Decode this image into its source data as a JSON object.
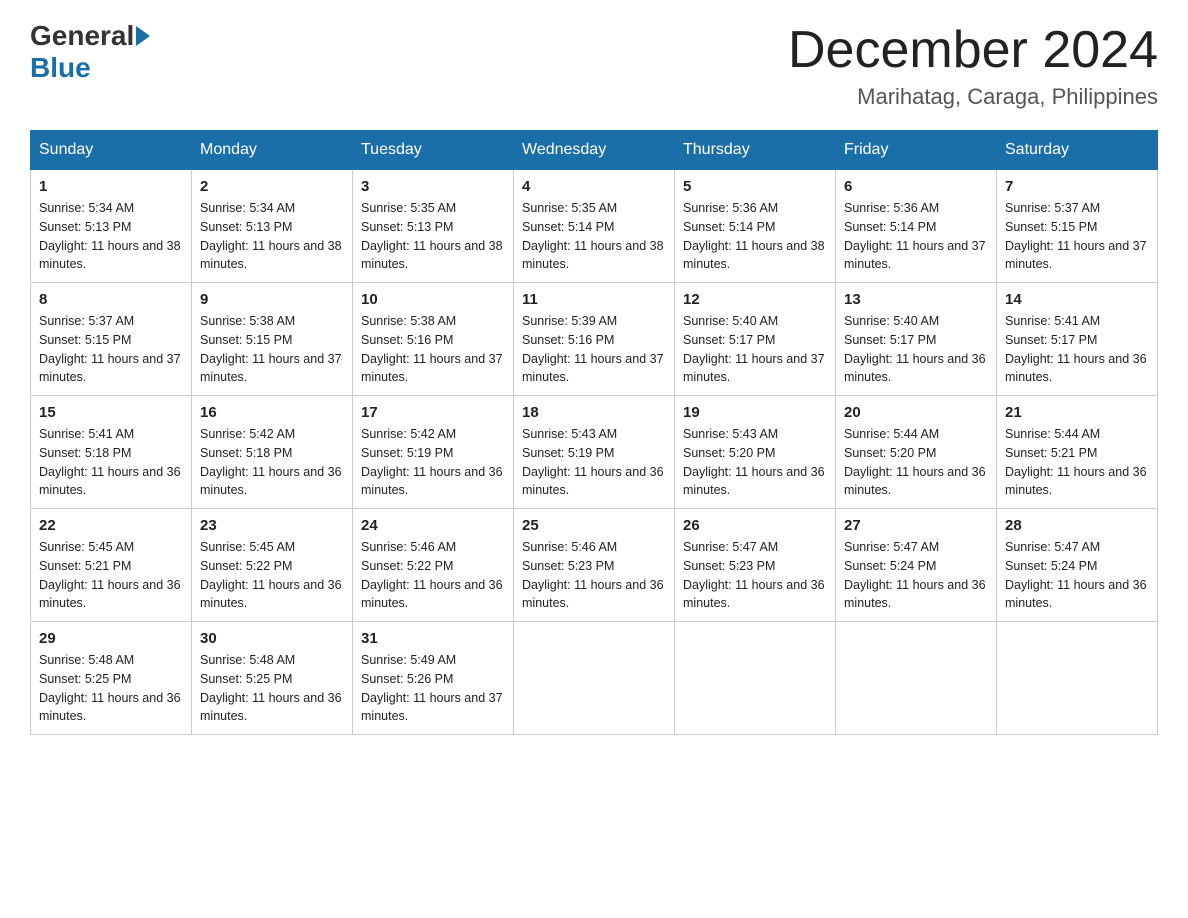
{
  "header": {
    "logo_general": "General",
    "logo_blue": "Blue",
    "month_title": "December 2024",
    "location": "Marihatag, Caraga, Philippines"
  },
  "days_of_week": [
    "Sunday",
    "Monday",
    "Tuesday",
    "Wednesday",
    "Thursday",
    "Friday",
    "Saturday"
  ],
  "weeks": [
    [
      {
        "day": "1",
        "sunrise": "5:34 AM",
        "sunset": "5:13 PM",
        "daylight": "11 hours and 38 minutes."
      },
      {
        "day": "2",
        "sunrise": "5:34 AM",
        "sunset": "5:13 PM",
        "daylight": "11 hours and 38 minutes."
      },
      {
        "day": "3",
        "sunrise": "5:35 AM",
        "sunset": "5:13 PM",
        "daylight": "11 hours and 38 minutes."
      },
      {
        "day": "4",
        "sunrise": "5:35 AM",
        "sunset": "5:14 PM",
        "daylight": "11 hours and 38 minutes."
      },
      {
        "day": "5",
        "sunrise": "5:36 AM",
        "sunset": "5:14 PM",
        "daylight": "11 hours and 38 minutes."
      },
      {
        "day": "6",
        "sunrise": "5:36 AM",
        "sunset": "5:14 PM",
        "daylight": "11 hours and 37 minutes."
      },
      {
        "day": "7",
        "sunrise": "5:37 AM",
        "sunset": "5:15 PM",
        "daylight": "11 hours and 37 minutes."
      }
    ],
    [
      {
        "day": "8",
        "sunrise": "5:37 AM",
        "sunset": "5:15 PM",
        "daylight": "11 hours and 37 minutes."
      },
      {
        "day": "9",
        "sunrise": "5:38 AM",
        "sunset": "5:15 PM",
        "daylight": "11 hours and 37 minutes."
      },
      {
        "day": "10",
        "sunrise": "5:38 AM",
        "sunset": "5:16 PM",
        "daylight": "11 hours and 37 minutes."
      },
      {
        "day": "11",
        "sunrise": "5:39 AM",
        "sunset": "5:16 PM",
        "daylight": "11 hours and 37 minutes."
      },
      {
        "day": "12",
        "sunrise": "5:40 AM",
        "sunset": "5:17 PM",
        "daylight": "11 hours and 37 minutes."
      },
      {
        "day": "13",
        "sunrise": "5:40 AM",
        "sunset": "5:17 PM",
        "daylight": "11 hours and 36 minutes."
      },
      {
        "day": "14",
        "sunrise": "5:41 AM",
        "sunset": "5:17 PM",
        "daylight": "11 hours and 36 minutes."
      }
    ],
    [
      {
        "day": "15",
        "sunrise": "5:41 AM",
        "sunset": "5:18 PM",
        "daylight": "11 hours and 36 minutes."
      },
      {
        "day": "16",
        "sunrise": "5:42 AM",
        "sunset": "5:18 PM",
        "daylight": "11 hours and 36 minutes."
      },
      {
        "day": "17",
        "sunrise": "5:42 AM",
        "sunset": "5:19 PM",
        "daylight": "11 hours and 36 minutes."
      },
      {
        "day": "18",
        "sunrise": "5:43 AM",
        "sunset": "5:19 PM",
        "daylight": "11 hours and 36 minutes."
      },
      {
        "day": "19",
        "sunrise": "5:43 AM",
        "sunset": "5:20 PM",
        "daylight": "11 hours and 36 minutes."
      },
      {
        "day": "20",
        "sunrise": "5:44 AM",
        "sunset": "5:20 PM",
        "daylight": "11 hours and 36 minutes."
      },
      {
        "day": "21",
        "sunrise": "5:44 AM",
        "sunset": "5:21 PM",
        "daylight": "11 hours and 36 minutes."
      }
    ],
    [
      {
        "day": "22",
        "sunrise": "5:45 AM",
        "sunset": "5:21 PM",
        "daylight": "11 hours and 36 minutes."
      },
      {
        "day": "23",
        "sunrise": "5:45 AM",
        "sunset": "5:22 PM",
        "daylight": "11 hours and 36 minutes."
      },
      {
        "day": "24",
        "sunrise": "5:46 AM",
        "sunset": "5:22 PM",
        "daylight": "11 hours and 36 minutes."
      },
      {
        "day": "25",
        "sunrise": "5:46 AM",
        "sunset": "5:23 PM",
        "daylight": "11 hours and 36 minutes."
      },
      {
        "day": "26",
        "sunrise": "5:47 AM",
        "sunset": "5:23 PM",
        "daylight": "11 hours and 36 minutes."
      },
      {
        "day": "27",
        "sunrise": "5:47 AM",
        "sunset": "5:24 PM",
        "daylight": "11 hours and 36 minutes."
      },
      {
        "day": "28",
        "sunrise": "5:47 AM",
        "sunset": "5:24 PM",
        "daylight": "11 hours and 36 minutes."
      }
    ],
    [
      {
        "day": "29",
        "sunrise": "5:48 AM",
        "sunset": "5:25 PM",
        "daylight": "11 hours and 36 minutes."
      },
      {
        "day": "30",
        "sunrise": "5:48 AM",
        "sunset": "5:25 PM",
        "daylight": "11 hours and 36 minutes."
      },
      {
        "day": "31",
        "sunrise": "5:49 AM",
        "sunset": "5:26 PM",
        "daylight": "11 hours and 37 minutes."
      },
      null,
      null,
      null,
      null
    ]
  ],
  "labels": {
    "sunrise": "Sunrise:",
    "sunset": "Sunset:",
    "daylight": "Daylight:"
  }
}
